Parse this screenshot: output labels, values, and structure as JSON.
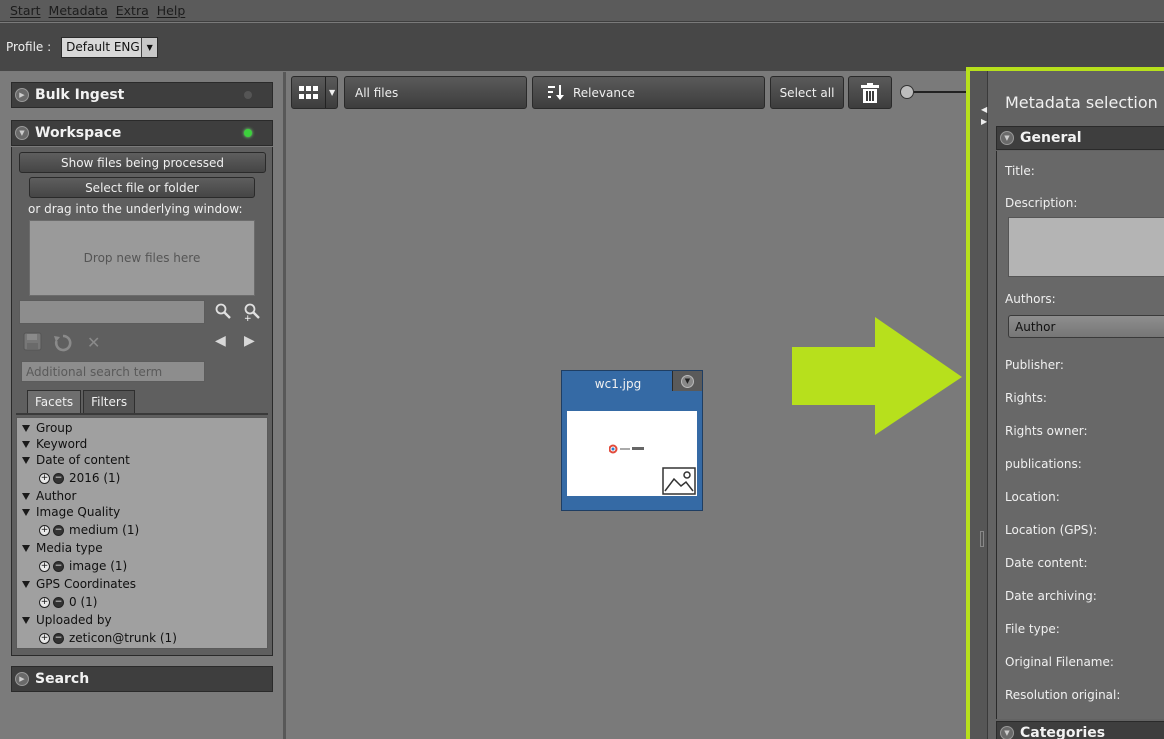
{
  "menu": [
    "Start",
    "Metadata",
    "Extra",
    "Help"
  ],
  "profile": {
    "label": "Profile :",
    "value": "Default ENG"
  },
  "left": {
    "bulk_ingest": "Bulk Ingest",
    "workspace": "Workspace",
    "show_files_btn": "Show files being processed",
    "select_file_btn": "Select file or folder",
    "drag_text": "or drag into the underlying window:",
    "dropzone": "Drop new files here",
    "additional_search_placeholder": "Additional search term",
    "tabs": [
      "Facets",
      "Filters"
    ],
    "facets": [
      {
        "type": "group",
        "label": "Group"
      },
      {
        "type": "group",
        "label": "Keyword"
      },
      {
        "type": "group",
        "label": "Date of content"
      },
      {
        "type": "value",
        "label": "2016 (1)"
      },
      {
        "type": "group",
        "label": "Author"
      },
      {
        "type": "group",
        "label": "Image Quality"
      },
      {
        "type": "value",
        "label": "medium (1)"
      },
      {
        "type": "group",
        "label": "Media type"
      },
      {
        "type": "value",
        "label": "image (1)"
      },
      {
        "type": "group",
        "label": "GPS Coordinates"
      },
      {
        "type": "value",
        "label": "0 (1)"
      },
      {
        "type": "group",
        "label": "Uploaded by"
      },
      {
        "type": "value",
        "label": "zeticon@trunk (1)"
      }
    ],
    "search": "Search"
  },
  "toolbar": {
    "filter": "All files",
    "sort": "Relevance",
    "select_all": "Select all"
  },
  "thumbnail": {
    "filename": "wc1.jpg"
  },
  "right": {
    "title": "Metadata selection",
    "general": "General",
    "fields": [
      "Title:",
      "Description:",
      "Authors:",
      "Publisher:",
      "Rights:",
      "Rights owner:",
      "publications:",
      "Location:",
      "Location (GPS):",
      "Date content:",
      "Date archiving:",
      "File type:",
      "Original Filename:",
      "Resolution original:"
    ],
    "author_select": "Author",
    "categories": "Categories"
  },
  "colors": {
    "accent": "#b7e01c",
    "thumb_bg": "#356aa5",
    "led_on": "#3cd13c"
  }
}
